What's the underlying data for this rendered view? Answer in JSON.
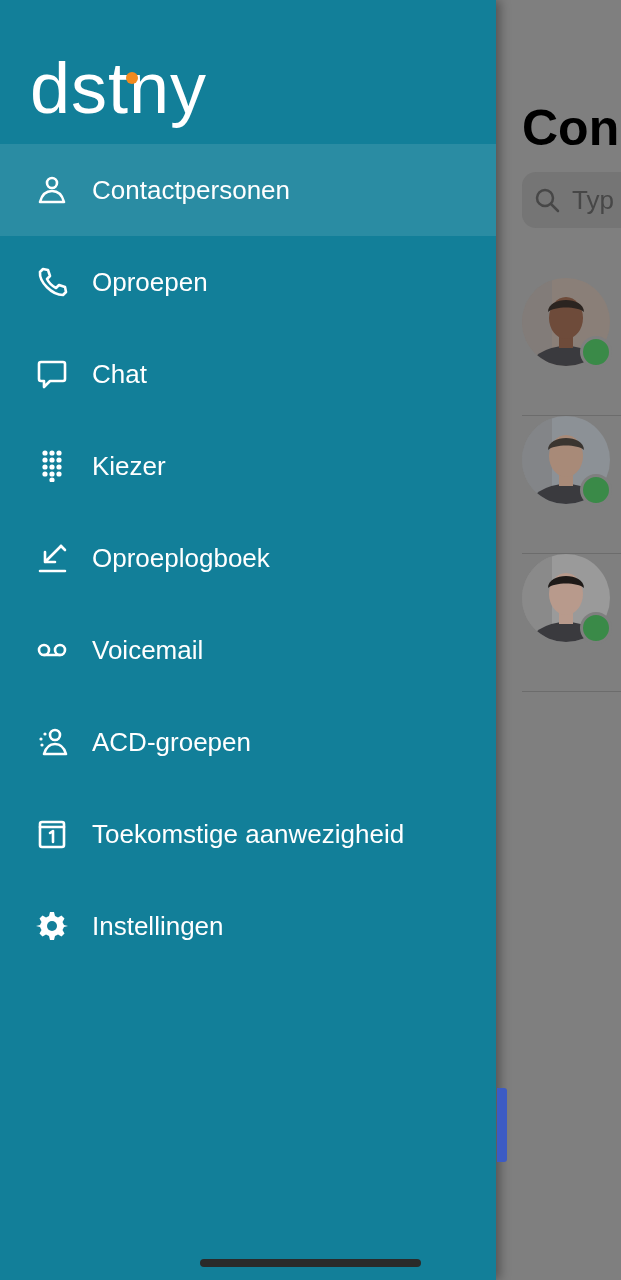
{
  "drawer": {
    "logo": "dstny",
    "items": [
      {
        "label": "Contactpersonen",
        "selected": true
      },
      {
        "label": "Oproepen",
        "selected": false
      },
      {
        "label": "Chat",
        "selected": false
      },
      {
        "label": "Kiezer",
        "selected": false
      },
      {
        "label": "Oproeplogboek",
        "selected": false
      },
      {
        "label": "Voicemail",
        "selected": false
      },
      {
        "label": "ACD-groepen",
        "selected": false
      },
      {
        "label": "Toekomstige aanwezigheid",
        "selected": false
      },
      {
        "label": "Instellingen",
        "selected": false
      }
    ]
  },
  "background": {
    "title": "Con",
    "search": {
      "placeholder": "Typ"
    }
  }
}
